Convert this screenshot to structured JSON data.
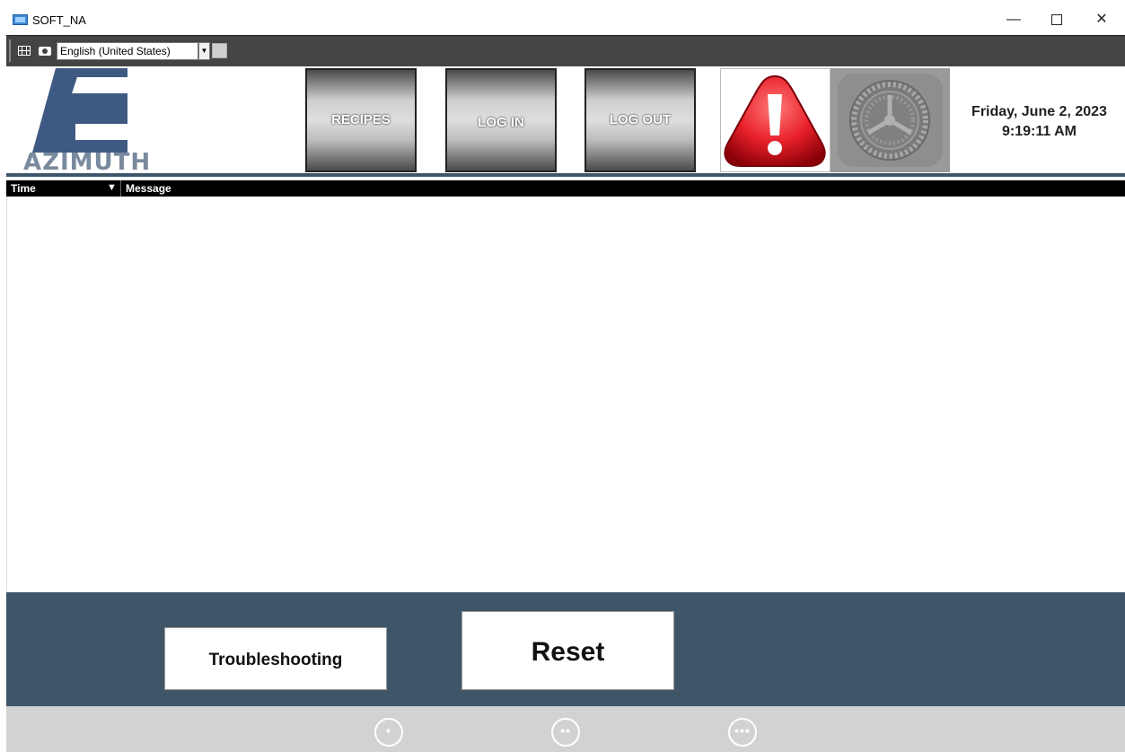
{
  "window": {
    "title": "SOFT_NA",
    "minimize": "—",
    "close": "✕"
  },
  "toolbar": {
    "language": "English (United States)"
  },
  "header": {
    "logo_text": "AZIMUTH",
    "buttons": {
      "recipes": "RECIPES",
      "login": "LOG IN",
      "logout": "LOG OUT"
    },
    "date": "Friday, June 2, 2023",
    "time": "9:19:11 AM"
  },
  "messages": {
    "columns": {
      "time": "Time",
      "message": "Message"
    },
    "rows": []
  },
  "footer": {
    "troubleshooting": "Troubleshooting",
    "reset": "Reset"
  },
  "bottom_bar": {
    "dots": [
      "•",
      "••",
      "•••"
    ]
  },
  "colors": {
    "panel": "#3f5669",
    "alarm": "#e8202a",
    "logo": "#3f5a82"
  }
}
